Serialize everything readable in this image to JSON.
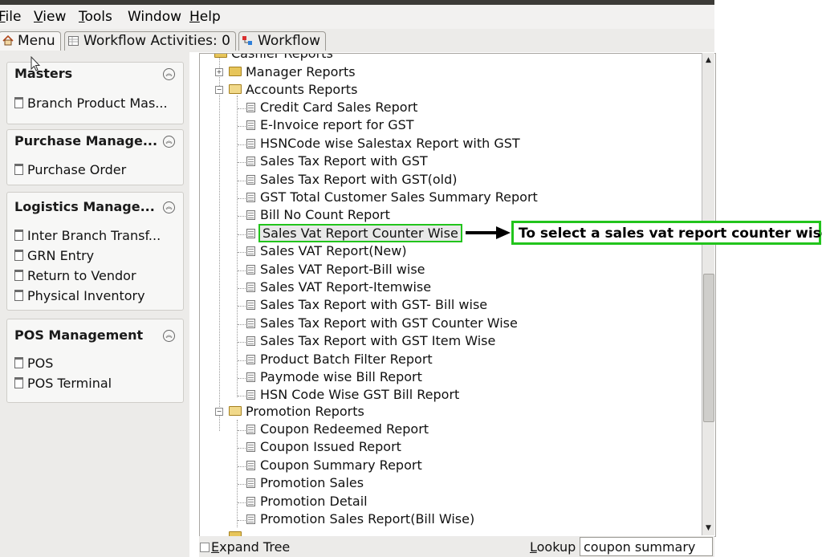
{
  "menubar": {
    "items": [
      {
        "label": "File",
        "underline": "F"
      },
      {
        "label": "View",
        "underline": "V"
      },
      {
        "label": "Tools",
        "underline": "T"
      },
      {
        "label": "Window",
        "underline": ""
      },
      {
        "label": "Help",
        "underline": "H"
      }
    ]
  },
  "tabs": [
    {
      "label": "Menu",
      "icon": "home-icon",
      "active": true
    },
    {
      "label": "Workflow Activities: 0",
      "icon": "table-icon",
      "active": false
    },
    {
      "label": "Workflow",
      "icon": "workflow-icon",
      "active": false
    }
  ],
  "sidebar": {
    "sections": [
      {
        "title": "Masters",
        "items": [
          "Branch Product Mas..."
        ]
      },
      {
        "title": "Purchase Manage...",
        "items": [
          "Purchase Order"
        ]
      },
      {
        "title": "Logistics Manage...",
        "items": [
          "Inter Branch Transf...",
          "GRN Entry",
          "Return to Vendor",
          "Physical Inventory"
        ]
      },
      {
        "title": "POS Management",
        "items": [
          "POS",
          "POS Terminal"
        ]
      }
    ]
  },
  "tree": {
    "top_partial": "Cashier Reports",
    "manager": "Manager Reports",
    "accounts": "Accounts Reports",
    "accounts_items": [
      "Credit Card Sales Report",
      "E-Invoice report for GST",
      "HSNCode wise Salestax Report with GST",
      "Sales Tax Report with GST",
      "Sales Tax Report with GST(old)",
      "GST Total Customer Sales Summary Report",
      "Bill No Count Report",
      "Sales Vat Report Counter Wise",
      "Sales VAT Report(New)",
      "Sales VAT Report-Bill wise",
      "Sales VAT Report-Itemwise",
      "Sales Tax Report with GST- Bill wise",
      "Sales Tax Report with GST Counter Wise",
      "Sales Tax Report with GST Item Wise",
      "Product Batch Filter Report",
      "Paymode wise Bill Report",
      "HSN Code Wise GST Bill Report"
    ],
    "promotion": "Promotion Reports",
    "promotion_items": [
      "Coupon Redeemed Report",
      "Coupon Issued Report",
      "Coupon Summary Report",
      "Promotion Sales",
      "Promotion Detail",
      "Promotion Sales Report(Bill Wise)"
    ],
    "selected": "Sales Vat Report Counter Wise"
  },
  "annotation": "To select a sales vat report counter wise",
  "bottom": {
    "expand_tree": "Expand Tree",
    "lookup_label": "Lookup",
    "lookup_value": "coupon summary"
  },
  "colors": {
    "highlight": "#22c41c",
    "panel": "#ecebe9"
  }
}
